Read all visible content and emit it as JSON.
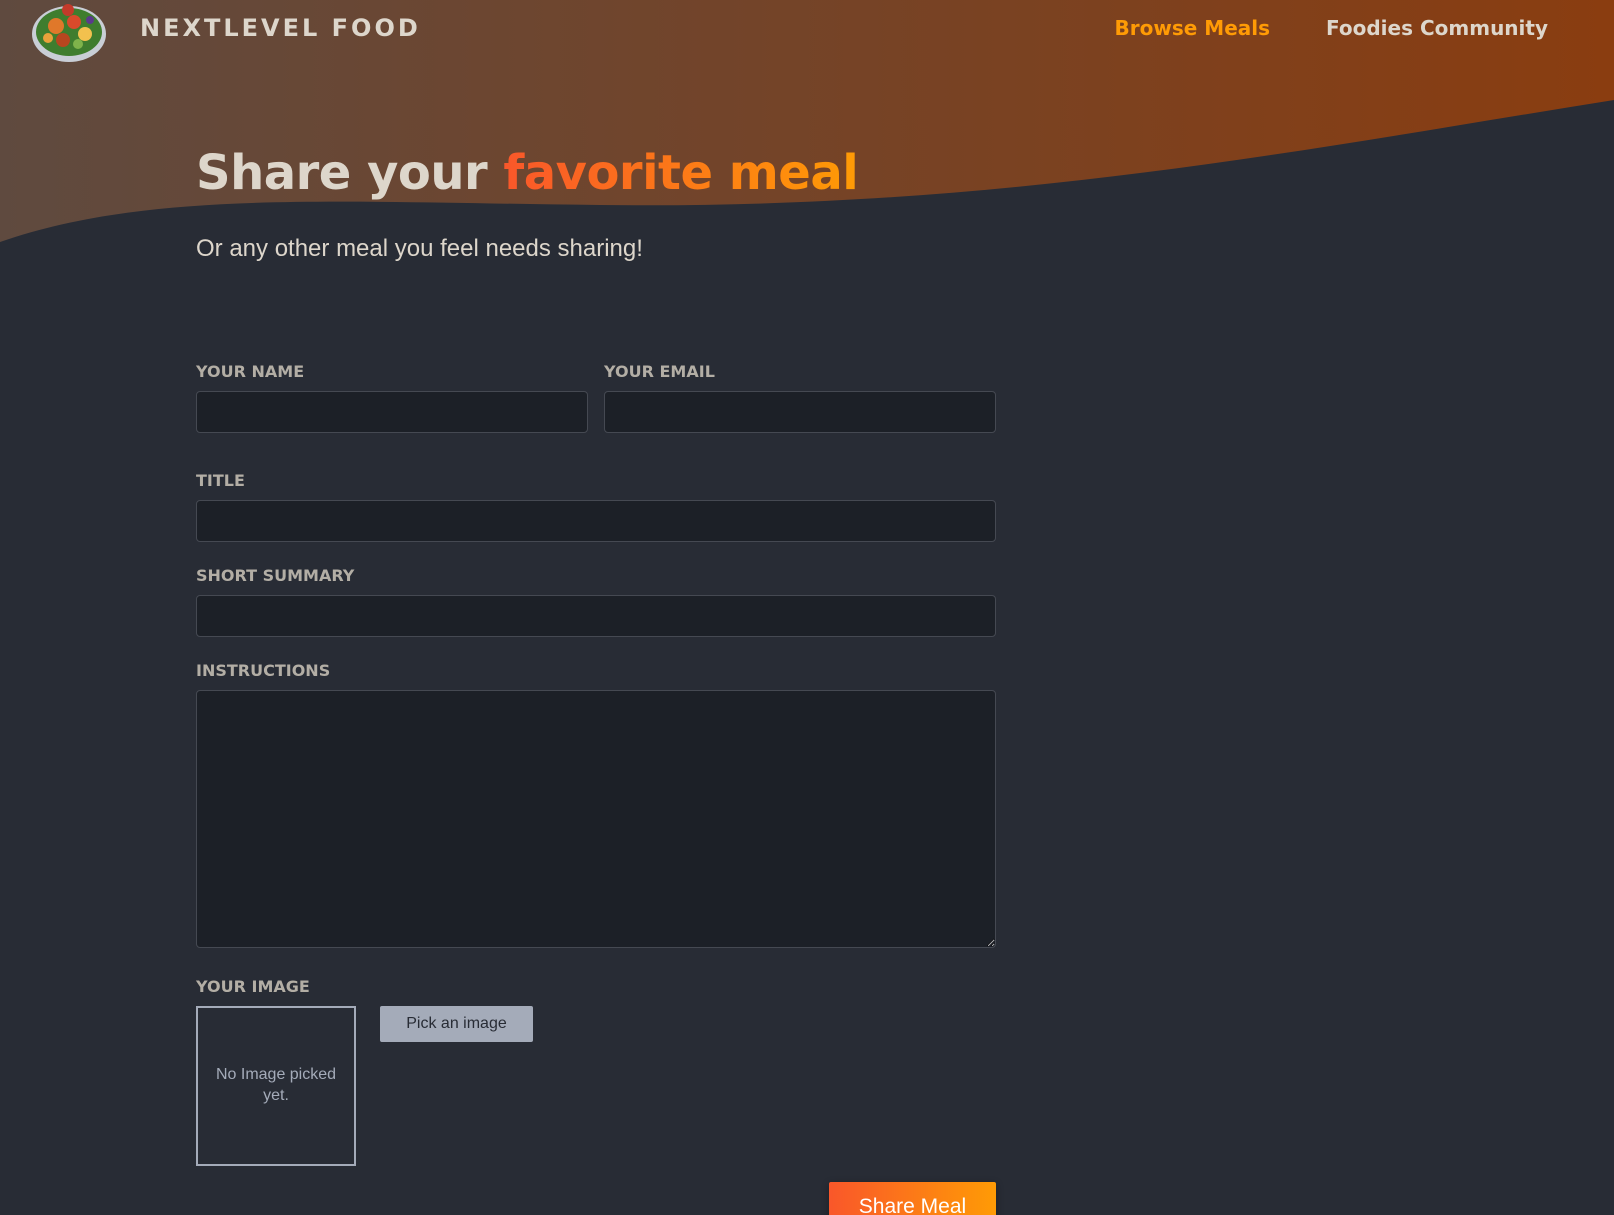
{
  "brand": {
    "name": "NEXTLEVEL FOOD",
    "logo_icon": "food-plate-logo-icon"
  },
  "nav": {
    "items": [
      {
        "label": "Browse Meals",
        "active": true
      },
      {
        "label": "Foodies Community",
        "active": false
      }
    ]
  },
  "hero": {
    "title_prefix": "Share your ",
    "title_highlight": "favorite meal",
    "subtitle": "Or any other meal you feel needs sharing!"
  },
  "form": {
    "name_label": "Your name",
    "email_label": "Your email",
    "title_label": "Title",
    "summary_label": "Short Summary",
    "instructions_label": "Instructions",
    "name_value": "",
    "email_value": "",
    "title_value": "",
    "summary_value": "",
    "instructions_value": "",
    "image": {
      "label": "Your image",
      "preview_text": "No Image picked yet.",
      "pick_label": "Pick an image"
    },
    "submit_label": "Share Meal"
  },
  "colors": {
    "background": "#282c35",
    "accent_start": "#f9572a",
    "accent_end": "#ff9b05",
    "text": "#ddd6cb",
    "header_wave_start": "#5f4a3f",
    "header_wave_end": "#8a3d10"
  }
}
